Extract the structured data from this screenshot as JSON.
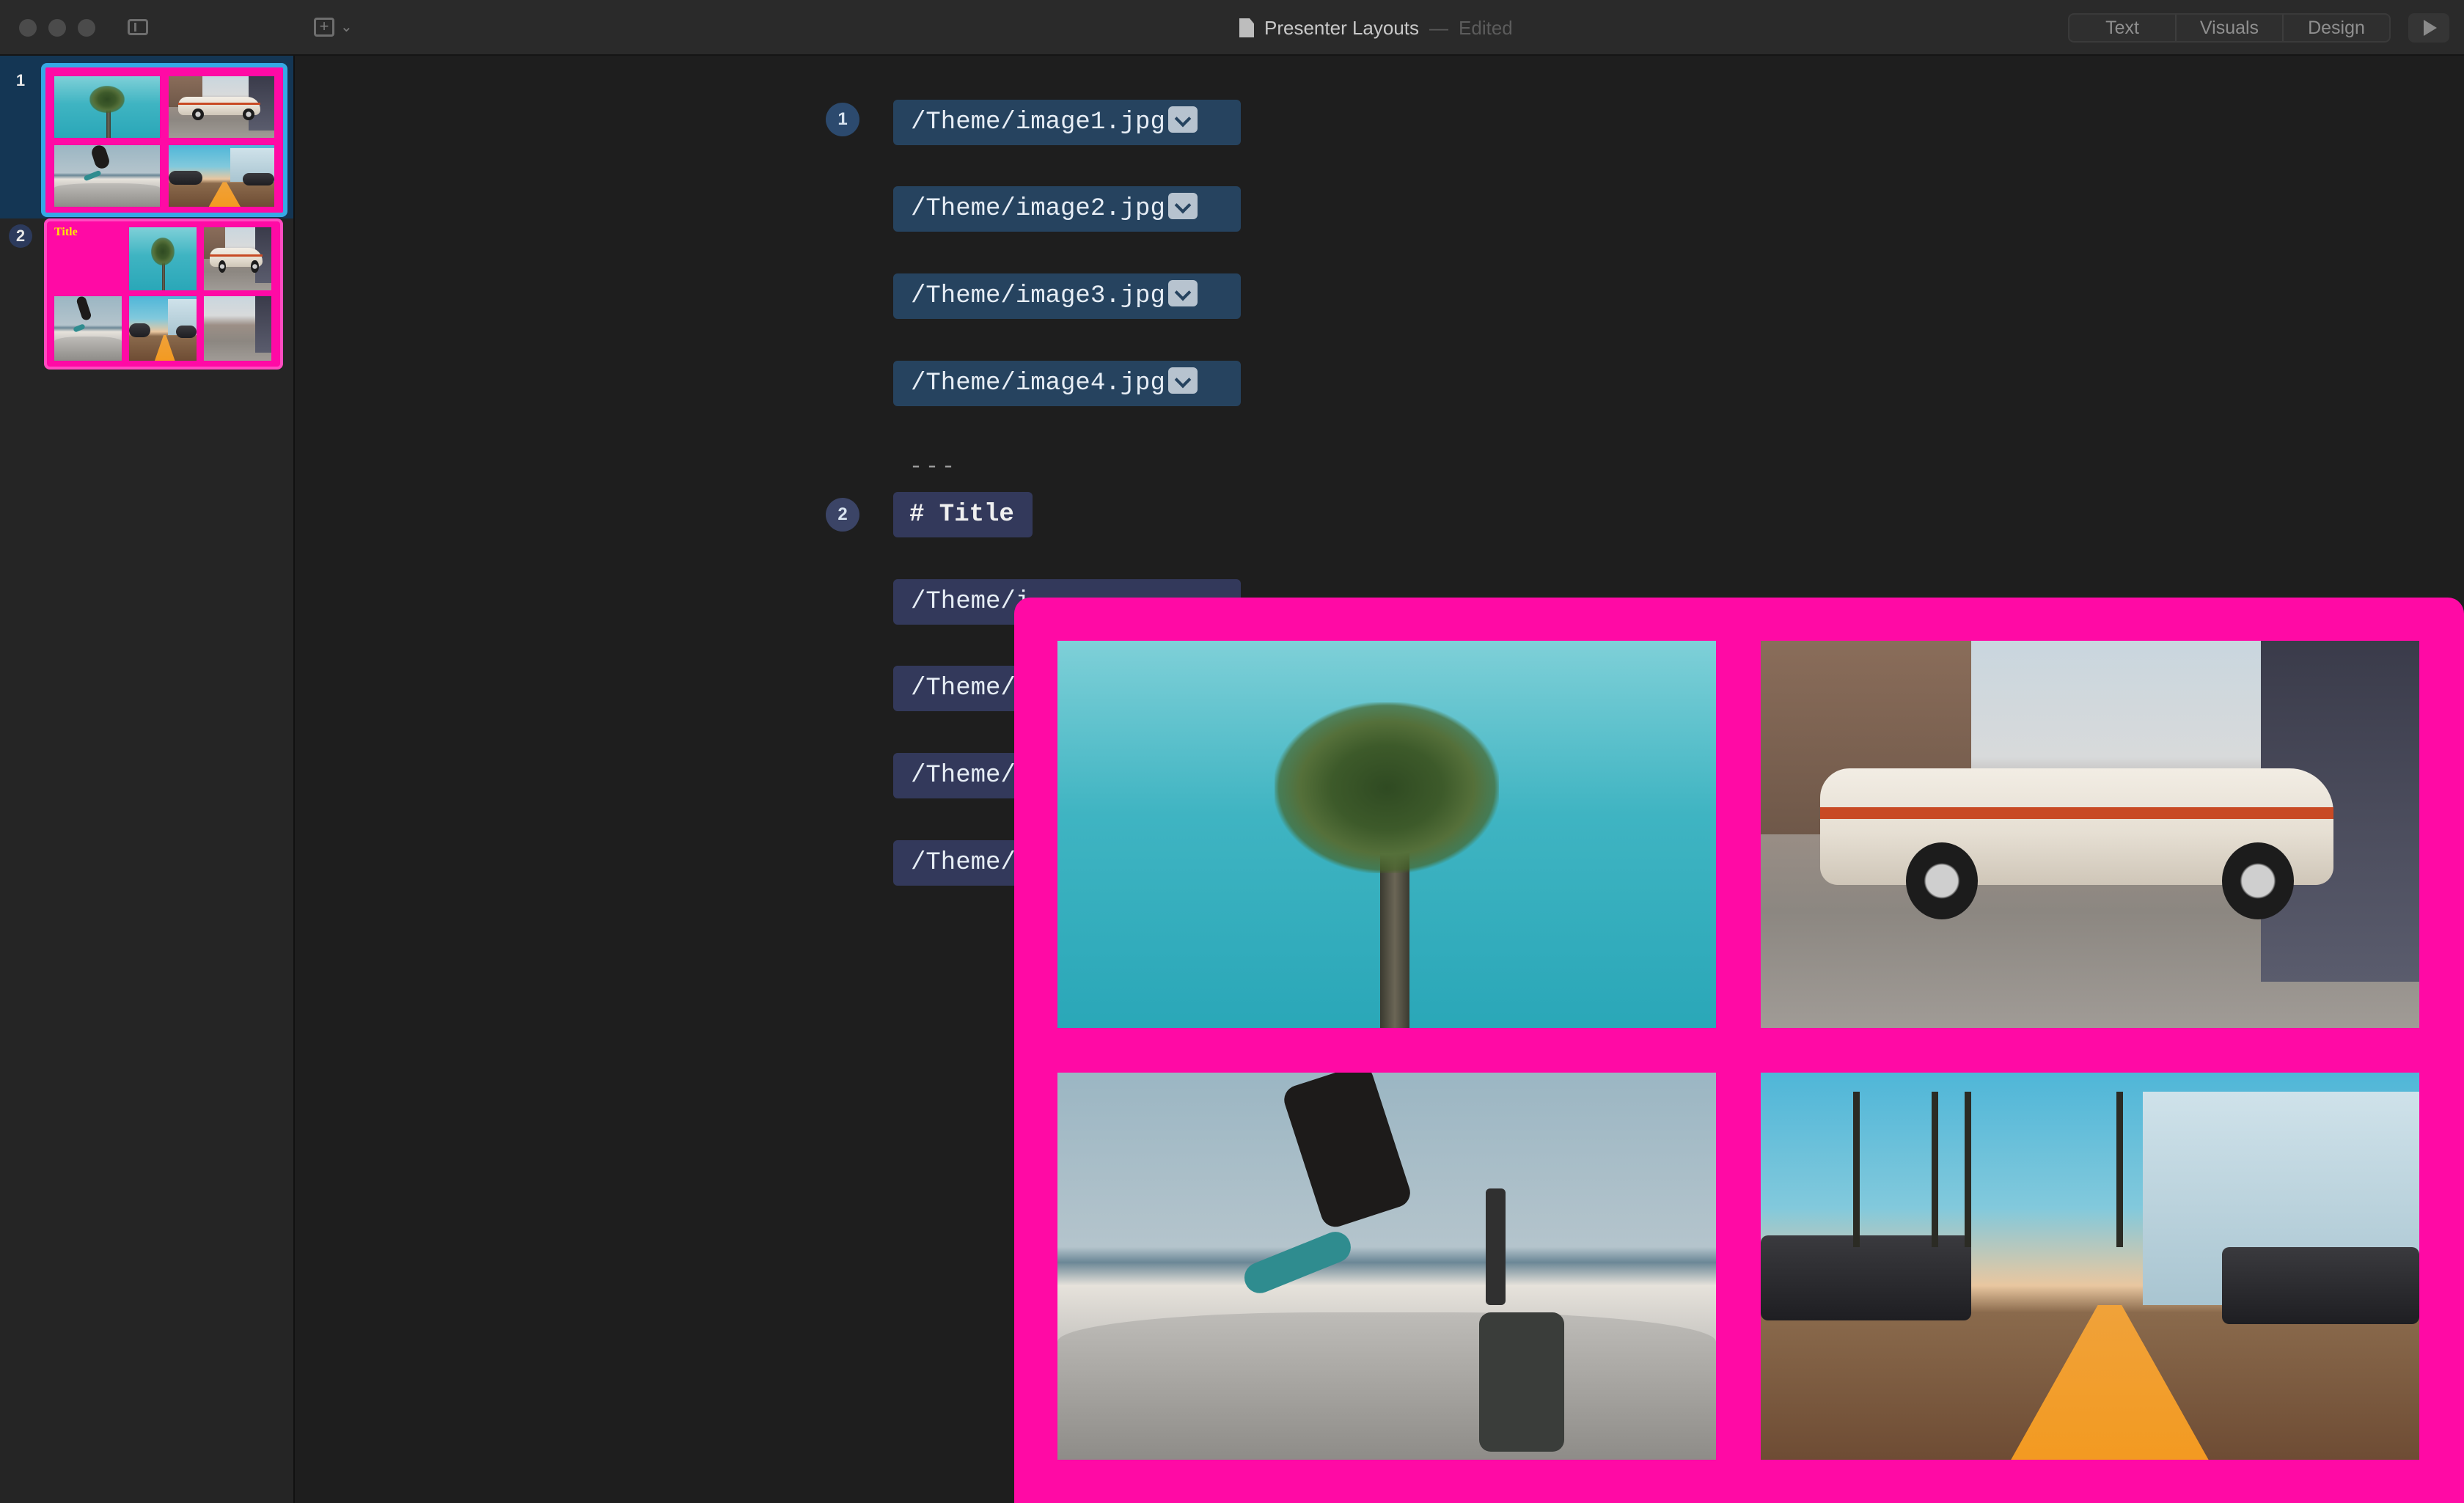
{
  "window": {
    "title": "Presenter Layouts",
    "title_separator": "—",
    "status": "Edited"
  },
  "toolbar": {
    "sidebar_toggle_icon": "sidebar-icon",
    "add_slide_icon": "add-slide-icon",
    "segments": [
      "Text",
      "Visuals",
      "Design"
    ],
    "play_icon": "play-icon"
  },
  "sidebar": {
    "slides": [
      {
        "number": "1",
        "selected": true
      },
      {
        "number": "2",
        "selected": false,
        "thumb_title": "Title"
      }
    ]
  },
  "editor": {
    "slide1": {
      "badge": "1",
      "images": [
        "/Theme/image1.jpg",
        "/Theme/image2.jpg",
        "/Theme/image3.jpg",
        "/Theme/image4.jpg"
      ]
    },
    "separator": "---",
    "slide2": {
      "badge": "2",
      "heading": "# Title",
      "images": [
        "/Theme/i",
        "/Theme/",
        "/Theme/",
        "/Theme/"
      ]
    }
  },
  "preview": {
    "background_color": "#ff0aa5",
    "images": [
      "palm-tree",
      "classic-car",
      "skateboarder",
      "street-sunset"
    ]
  },
  "colors": {
    "accent_selection": "#35a9e6",
    "slide_background": "#ff0aa5",
    "token_blue": "#26435f",
    "token_purple": "#33395b"
  }
}
